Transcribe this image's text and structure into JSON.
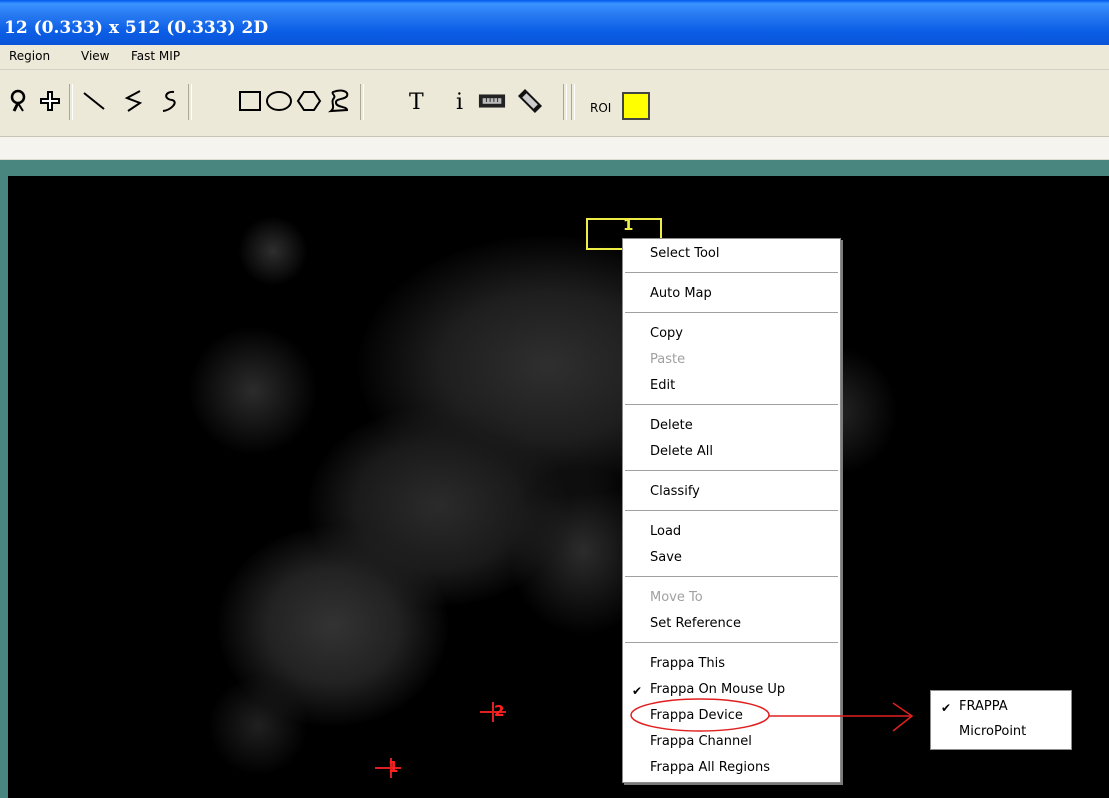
{
  "window": {
    "title": "12 (0.333) x 512 (0.333) 2D"
  },
  "menubar": {
    "items": [
      "Region",
      "View",
      "Fast MIP"
    ]
  },
  "toolbar": {
    "tools": [
      "magnifier-icon",
      "crosshair-icon",
      "line-icon",
      "polyline-icon",
      "freehand-line-icon",
      "rectangle-icon",
      "ellipse-icon",
      "polygon-icon",
      "freehand-region-icon",
      "text-icon",
      "info-icon",
      "ruler-icon",
      "calibration-icon"
    ],
    "roi_label": "ROI",
    "roi_color": "#ffff00"
  },
  "image": {
    "roi_number": "1",
    "markers": [
      "2",
      "1"
    ]
  },
  "context_menu": {
    "items": [
      {
        "label": "Select Tool",
        "enabled": true
      },
      {
        "label": "Auto Map",
        "enabled": true
      },
      {
        "label": "Copy",
        "enabled": true
      },
      {
        "label": "Paste",
        "enabled": false
      },
      {
        "label": "Edit",
        "enabled": true
      },
      {
        "label": "Delete",
        "enabled": true
      },
      {
        "label": "Delete All",
        "enabled": true
      },
      {
        "label": "Classify",
        "enabled": true
      },
      {
        "label": "Load",
        "enabled": true
      },
      {
        "label": "Save",
        "enabled": true
      },
      {
        "label": "Move To",
        "enabled": false
      },
      {
        "label": "Set Reference",
        "enabled": true
      },
      {
        "label": "Frappa This",
        "enabled": true
      },
      {
        "label": "Frappa On Mouse Up",
        "enabled": true,
        "checked": true
      },
      {
        "label": "Frappa Device",
        "enabled": true,
        "highlighted": true
      },
      {
        "label": "Frappa Channel",
        "enabled": true
      },
      {
        "label": "Frappa All Regions",
        "enabled": true
      }
    ]
  },
  "submenu": {
    "items": [
      {
        "label": "FRAPPA",
        "checked": true
      },
      {
        "label": "MicroPoint",
        "checked": false
      }
    ]
  },
  "colors": {
    "annotation_red": "#e02020",
    "roi_yellow": "#eeee44",
    "titlebar_blue": "#0a54d8"
  }
}
